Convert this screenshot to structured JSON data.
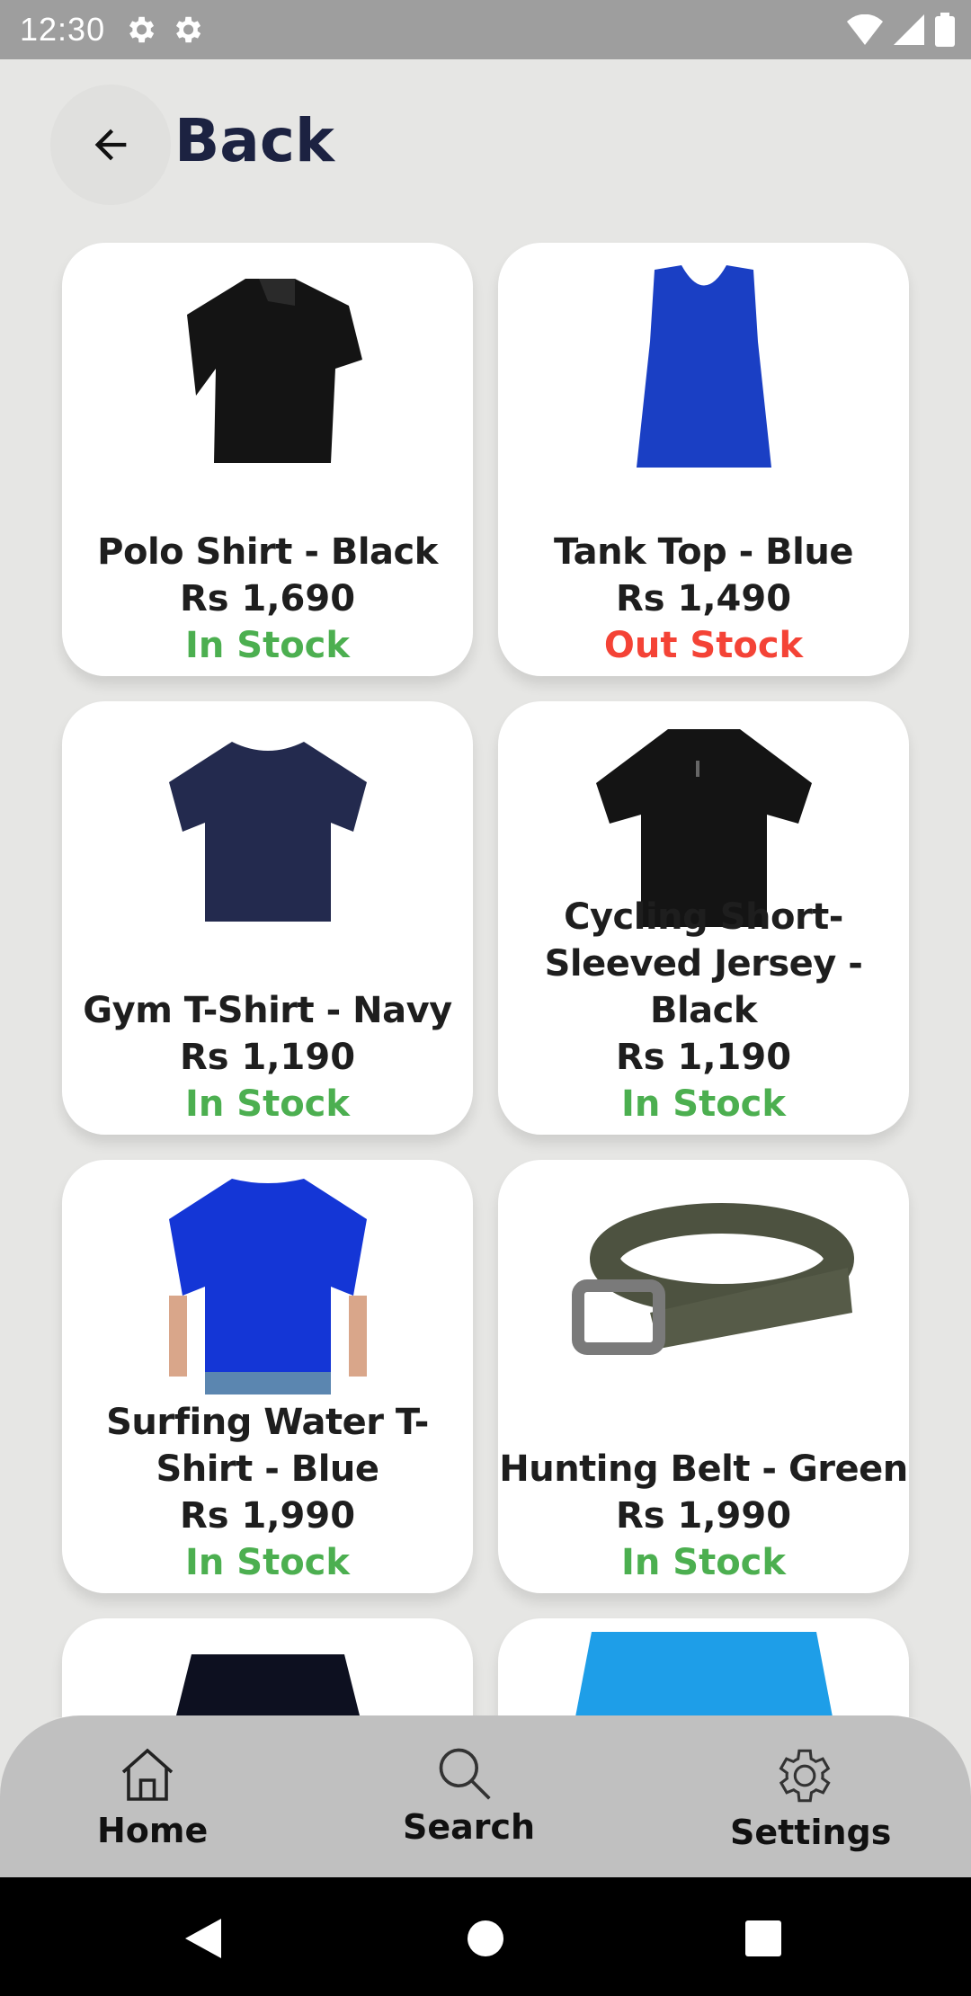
{
  "status_bar": {
    "time": "12:30"
  },
  "header": {
    "back_label": "Back"
  },
  "colors": {
    "in_stock": "#4caf50",
    "out_stock": "#f44336",
    "title": "#1c2241"
  },
  "products": [
    {
      "name": "Polo Shirt - Black",
      "price": "Rs 1,690",
      "stock": "In Stock",
      "image": "polo-shirt-black"
    },
    {
      "name": "Tank Top - Blue",
      "price": "Rs 1,490",
      "stock": "Out Stock",
      "image": "tank-top-blue"
    },
    {
      "name": "Gym T-Shirt - Navy",
      "price": "Rs 1,190",
      "stock": "In Stock",
      "image": "gym-tshirt-navy"
    },
    {
      "name": "Cycling Short-Sleeved Jersey - Black",
      "price": "Rs 1,190",
      "stock": "In Stock",
      "image": "cycling-jersey-black"
    },
    {
      "name": "Surfing Water T-Shirt - Blue",
      "price": "Rs 1,990",
      "stock": "In Stock",
      "image": "surfing-tshirt-blue"
    },
    {
      "name": "Hunting Belt - Green",
      "price": "Rs 1,990",
      "stock": "In Stock",
      "image": "hunting-belt-green"
    }
  ],
  "bottom_nav": {
    "home": "Home",
    "search": "Search",
    "settings": "Settings"
  }
}
